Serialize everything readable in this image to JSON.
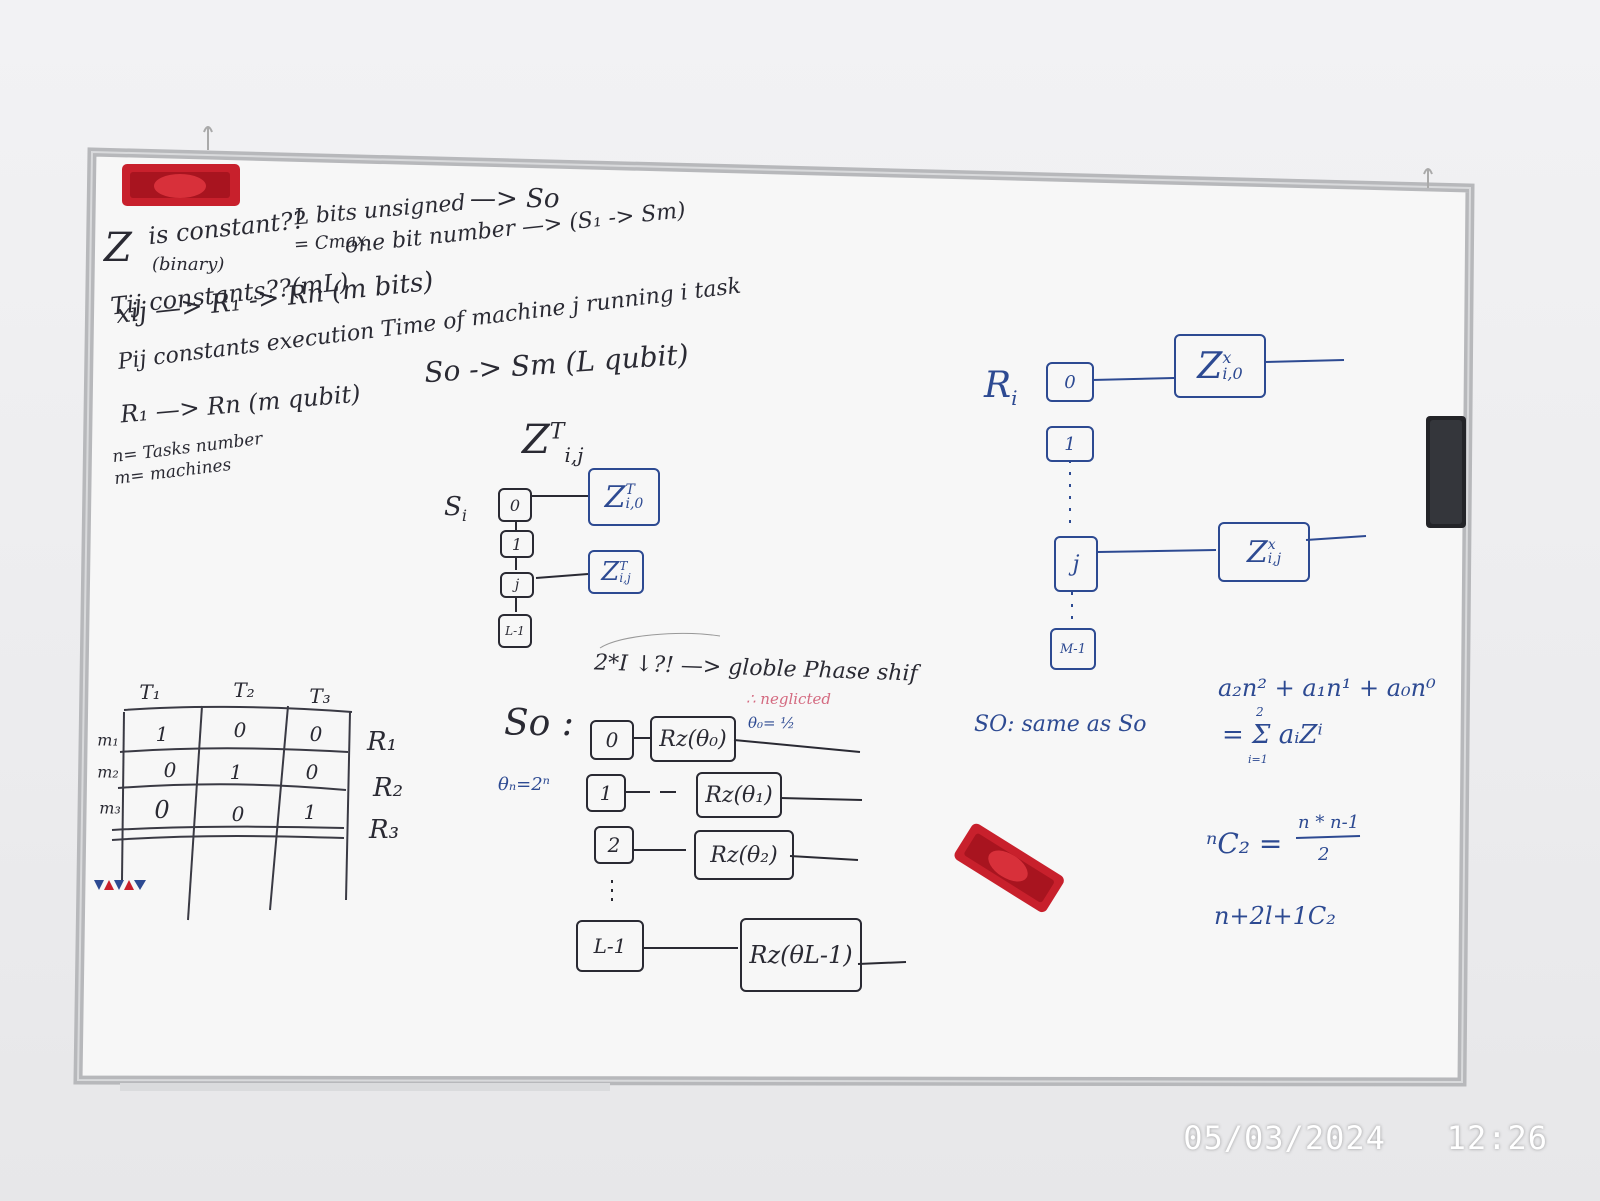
{
  "timestamp": {
    "date": "05/03/2024",
    "time": "12:26"
  },
  "left_notes": {
    "line1_z": "Z",
    "line1_rest": "is constant??",
    "line1_right": "L bits unsigned",
    "line1_arrow": "—> So",
    "binary": "(binary)",
    "cmax": "= Cmax",
    "one_bit": "one bit number —> (S₁ -> Sm)",
    "t_line": "Tij  constants??(mL)",
    "r_line": "xij —> R₁ -> Rn  (m bits)",
    "p_line": "Pij  constants  execution Time of machine j running i task",
    "so_sm": "So -> Sm  (L qubit)",
    "r_qubit": "R₁ —> Rn  (m qubit)",
    "n_tasks": "n= Tasks number",
    "m_machines": "m= machines"
  },
  "mid_diagram": {
    "z_label": "Z",
    "z_sup": "T",
    "z_sub": "i,j",
    "si": "S",
    "si_sub": "i",
    "cells": [
      "0",
      "1",
      "j",
      "L-1"
    ],
    "zbox1": "Z",
    "zbox1_sup": "T",
    "zbox1_sub": "i,0",
    "zbox2": "Z",
    "zbox2_sup": "T",
    "zbox2_sub": "i,j"
  },
  "phase_note": {
    "text": "2*I ↓?! —> globle Phase shif",
    "neglicted": "∴ neglicted",
    "theta0": "θ₀= ½"
  },
  "so_circuit": {
    "label": "So :",
    "theta_rule": "θₙ=2ⁿ",
    "rows": [
      {
        "index": "0",
        "gate": "Rz(θ₀)"
      },
      {
        "index": "1",
        "gate": "Rz(θ₁)"
      },
      {
        "index": "2",
        "gate": "Rz(θ₂)"
      },
      {
        "index": "L-1",
        "gate": "Rz(θL-1)"
      }
    ]
  },
  "table": {
    "cols": [
      "T₁",
      "T₂",
      "T₃"
    ],
    "rows": [
      {
        "m": "m₁",
        "vals": [
          "1",
          "0",
          "0"
        ],
        "r": "R₁"
      },
      {
        "m": "m₂",
        "vals": [
          "0",
          "1",
          "0"
        ],
        "r": "R₂"
      },
      {
        "m": "m₃",
        "vals": [
          "0",
          "0",
          "1"
        ],
        "r": "R₃"
      }
    ]
  },
  "right_diagram": {
    "ri": "R",
    "ri_sub": "i",
    "cells": [
      "0",
      "1",
      "j",
      "M-1"
    ],
    "zbox1": "Z",
    "zbox1_sup": "x",
    "zbox1_sub": "i,0",
    "zbox2": "Z",
    "zbox2_sup": "x",
    "zbox2_sub": "i,j"
  },
  "so_same": "SO: same as So",
  "formulas": {
    "poly": "a₂n² + a₁n¹ + a₀n⁰",
    "sum": "= Σ aᵢZⁱ",
    "sum_top": "2",
    "sum_bot": "i=1",
    "combo_left": "ⁿC₂ =",
    "combo_num": "n * n-1",
    "combo_den": "2",
    "combo2": "n+2l+1C₂"
  }
}
